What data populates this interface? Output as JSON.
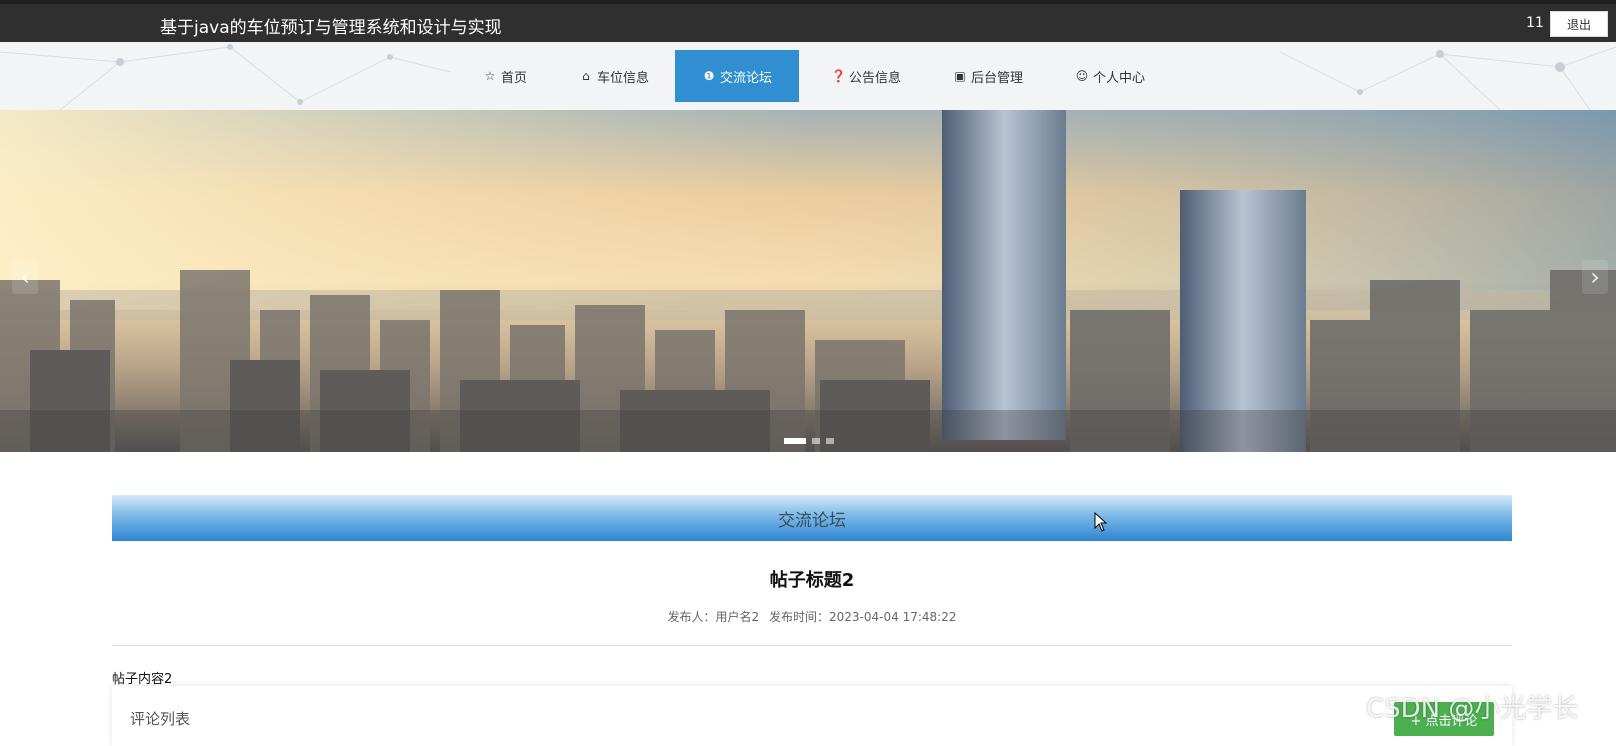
{
  "header": {
    "site_title": "基于java的车位预订与管理系统和设计与实现",
    "user_id": "11",
    "logout_label": "退出"
  },
  "nav": {
    "items": [
      {
        "label": "首页",
        "icon": "star-icon"
      },
      {
        "label": "车位信息",
        "icon": "bag-icon"
      },
      {
        "label": "交流论坛",
        "icon": "info-icon",
        "active": true
      },
      {
        "label": "公告信息",
        "icon": "question-icon"
      },
      {
        "label": "后台管理",
        "icon": "briefcase-icon"
      },
      {
        "label": "个人中心",
        "icon": "user-icon"
      }
    ]
  },
  "banner": {
    "slide_count": 3,
    "active_slide": 1
  },
  "section": {
    "title": "交流论坛"
  },
  "post": {
    "title": "帖子标题2",
    "author_label": "发布人：",
    "author": "用户名2",
    "time_label": "发布时间：",
    "time": "2023-04-04 17:48:22",
    "content": "帖子内容2"
  },
  "comments": {
    "title": "评论列表",
    "add_button": "+ 点击评论"
  },
  "watermark": "CSDN @小光学长",
  "colors": {
    "topbar": "#2f2f2f",
    "nav_active": "#2f8fd0",
    "section_bar": "#2f86cf",
    "comment_button": "#4caf50"
  }
}
